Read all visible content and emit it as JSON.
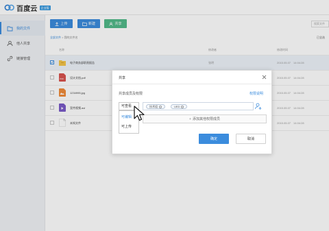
{
  "app": {
    "logo_text": "百度云",
    "logo_badge": "企业版"
  },
  "sidebar": {
    "items": [
      {
        "label": "我的文件",
        "icon": "folder-icon",
        "active": true
      },
      {
        "label": "他人共享",
        "icon": "people-icon",
        "active": false
      },
      {
        "label": "链接管理",
        "icon": "link-icon",
        "active": false
      }
    ]
  },
  "toolbar": {
    "upload_label": "上传",
    "newfolder_label": "新建",
    "share_label": "共享",
    "search_placeholder": "搜索文件"
  },
  "breadcrumb": {
    "root": "全部文件",
    "separator": " > ",
    "current": "我的文件名"
  },
  "right_label": "已全选",
  "table": {
    "headers": {
      "name": "名称",
      "size": "修改者",
      "date": "修改时间"
    },
    "rows": [
      {
        "name": "电子商务部职责报告",
        "size": "",
        "modifier": "张明",
        "date": "2015.05.07",
        "time": "14:04:28",
        "type": "folder",
        "checked": true
      },
      {
        "name": "设计文档.pdf",
        "size": "",
        "modifier": "",
        "date": "2015.05.07",
        "time": "14:04:28",
        "type": "pdf",
        "checked": false
      },
      {
        "name": "1234995.jpg",
        "size": "",
        "modifier": "",
        "date": "2015.05.07",
        "time": "14:04:28",
        "type": "jpg",
        "checked": false
      },
      {
        "name": "宣传视频.avi",
        "size": "",
        "modifier": "",
        "date": "2015.05.07",
        "time": "14:04:28",
        "type": "avi",
        "checked": false
      },
      {
        "name": "未知文件",
        "size": "",
        "modifier": "",
        "date": "2015.05.07",
        "time": "14:04:28",
        "type": "unknown",
        "checked": false
      }
    ]
  },
  "modal": {
    "title": "共享",
    "subtitle": "共享成员及权限",
    "link": "权限说明",
    "permission_selected": "可查看",
    "permission_options": [
      "可编辑",
      "可上传"
    ],
    "members": [
      "技术组",
      "UED"
    ],
    "add_other": "添加其他权限成员",
    "ok_label": "确定",
    "cancel_label": "取消"
  },
  "colors": {
    "accent": "#3b8cdd",
    "green": "#52b98a",
    "sidebar_bg": "#f0f2f5",
    "folder": "#f3c54b",
    "pdf": "#d9534f",
    "jpg": "#f08c3a",
    "avi": "#7a5bc8"
  }
}
